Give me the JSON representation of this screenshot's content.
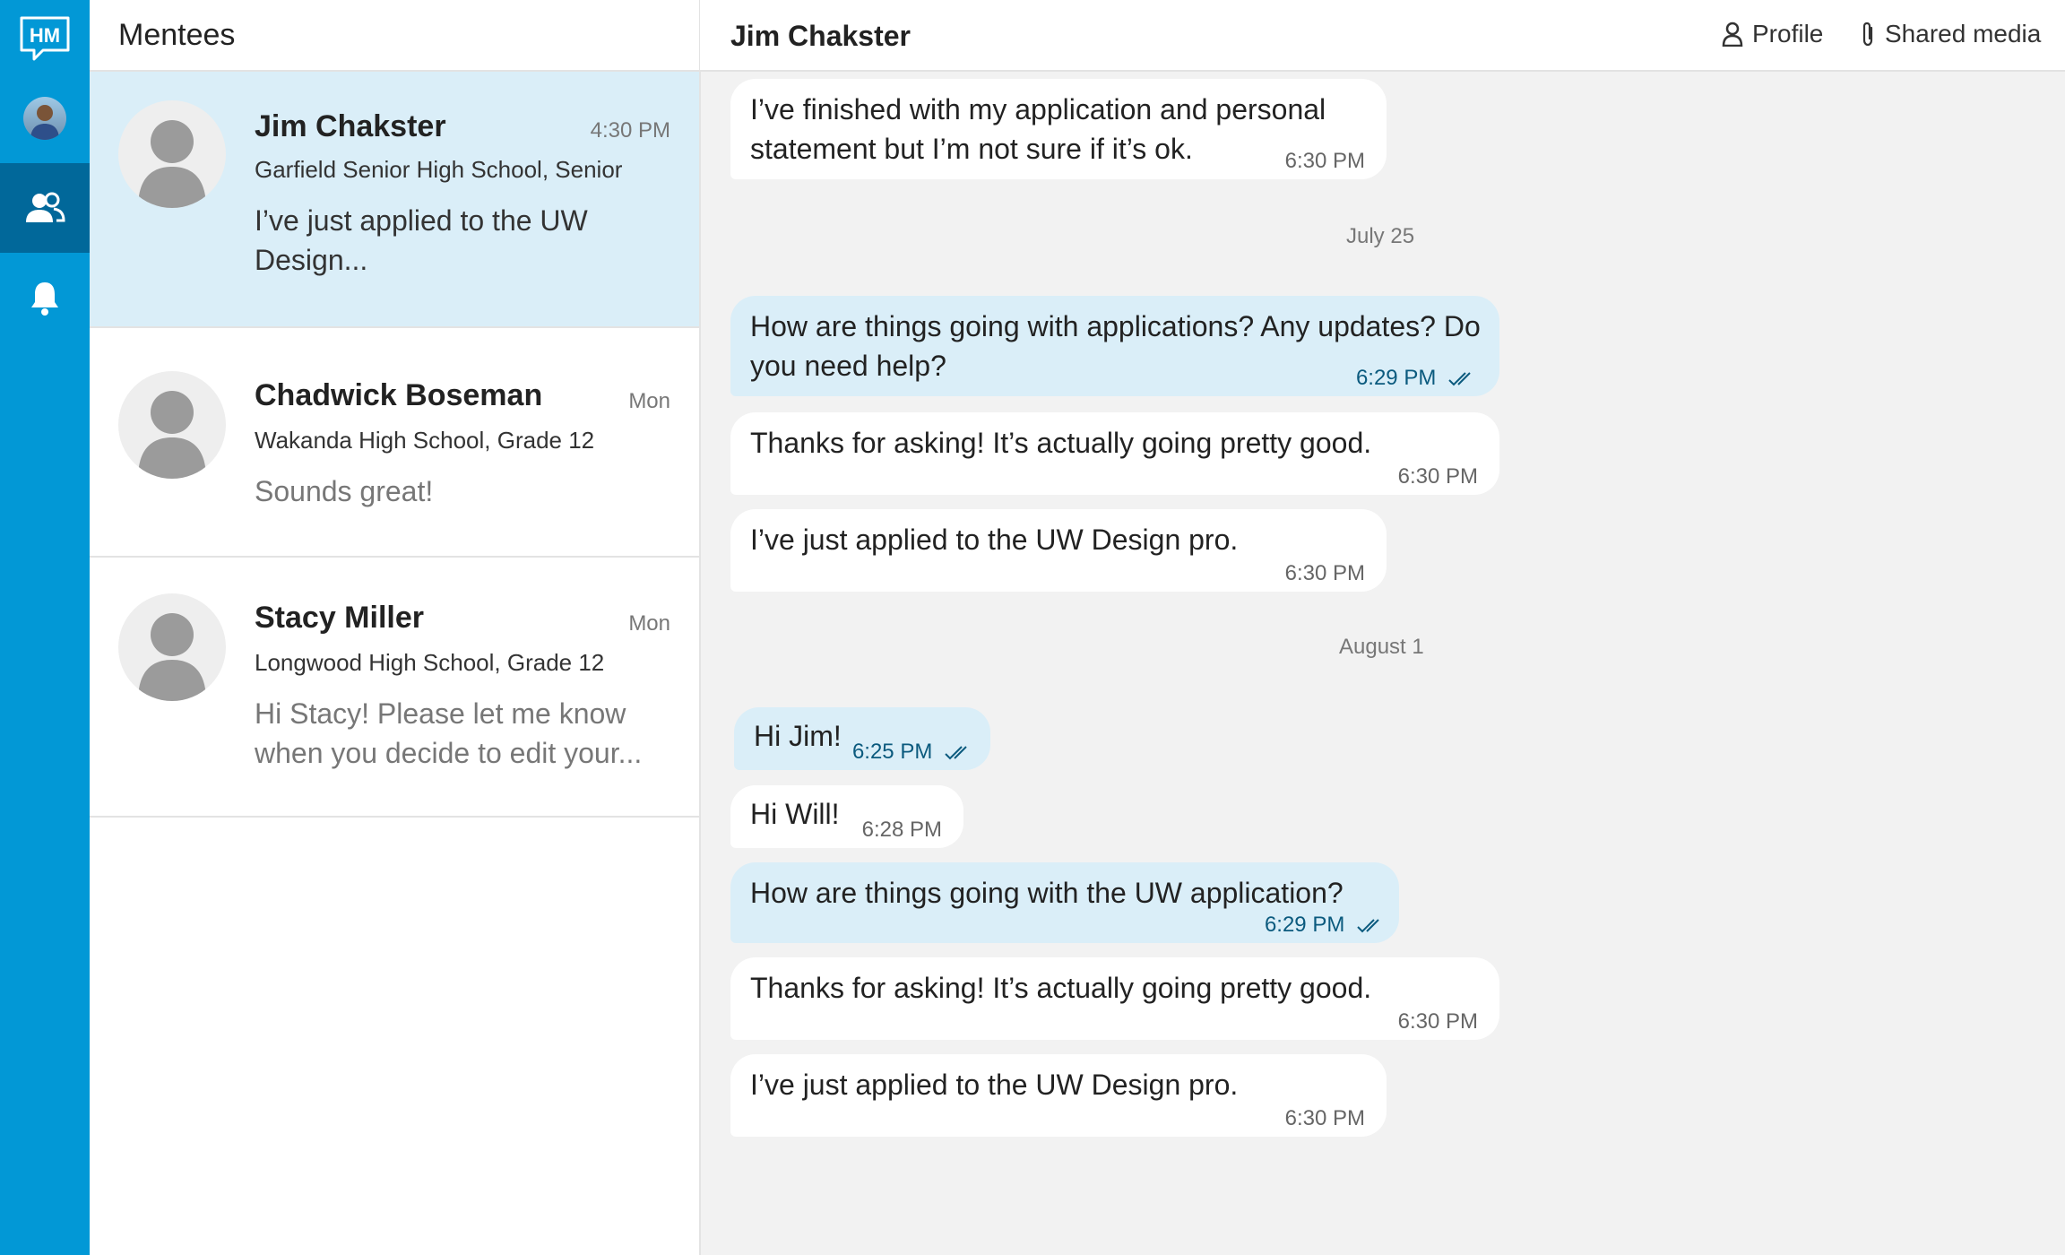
{
  "sidebar": {
    "logo_text": "HM",
    "items": [
      {
        "icon": "profile-avatar"
      },
      {
        "icon": "people-icon",
        "active": true
      },
      {
        "icon": "bell-icon"
      }
    ]
  },
  "mentees_panel": {
    "title": "Mentees",
    "mentees": [
      {
        "name": "Jim Chakster",
        "time": "4:30 PM",
        "school": "Garfield Senior High School, Senior",
        "preview": "I’ve just applied to the UW Design...",
        "active": true
      },
      {
        "name": "Chadwick Boseman",
        "time": "Mon",
        "school": "Wakanda High School, Grade 12",
        "preview": "Sounds great!"
      },
      {
        "name": "Stacy Miller",
        "time": "Mon",
        "school": "Longwood High School, Grade 12",
        "preview": "Hi Stacy! Please let me know when you decide to edit your..."
      }
    ]
  },
  "chat": {
    "title": "Jim Chakster",
    "profile_label": "Profile",
    "shared_media_label": "Shared media",
    "messages": [
      {
        "text": "I’ve finished with my application and personal statement but I’m not sure if it’s ok.",
        "time": "6:30 PM",
        "direction": "in"
      },
      {
        "text": "How are things going with applications? Any updates? Do you need help?",
        "time": "6:29 PM",
        "direction": "out",
        "read": true
      },
      {
        "text": "Thanks for asking! It’s actually going pretty good.",
        "time": "6:30 PM",
        "direction": "in"
      },
      {
        "text": "I’ve just applied to the UW Design pro.",
        "time": "6:30 PM",
        "direction": "in"
      },
      {
        "text": "Hi Jim!",
        "time": "6:25 PM",
        "direction": "out",
        "read": true
      },
      {
        "text": "Hi Will!",
        "time": "6:28 PM",
        "direction": "in"
      },
      {
        "text": "How are things going with the UW application?",
        "time": "6:29 PM",
        "direction": "out",
        "read": true
      },
      {
        "text": "Thanks for asking! It’s actually going pretty good.",
        "time": "6:30 PM",
        "direction": "in"
      },
      {
        "text": "I’ve just applied to the UW Design pro.",
        "time": "6:30 PM",
        "direction": "in"
      }
    ],
    "date_separators": [
      "July 25",
      "August 1"
    ]
  },
  "colors": {
    "sidebar_bg": "#0298d6",
    "sidebar_active": "#01689a",
    "selected_row": "#daeef8",
    "outgoing_bubble": "#daeef8",
    "incoming_bubble": "#ffffff",
    "chat_bg": "#f2f2f2"
  }
}
